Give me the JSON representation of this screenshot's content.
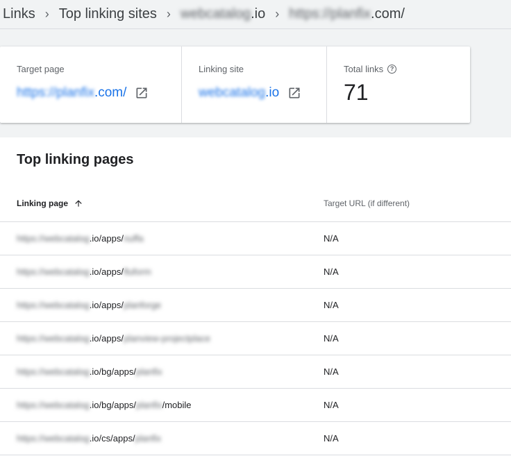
{
  "breadcrumb": {
    "links": "Links",
    "top_linking_sites": "Top linking sites",
    "site_blurred": "webcatalog",
    "site_suffix": ".io",
    "target_blurred": "https://planfix",
    "target_suffix": ".com/"
  },
  "summary": {
    "target_page": {
      "label": "Target page",
      "blurred": "https://planfix",
      "suffix": ".com/"
    },
    "linking_site": {
      "label": "Linking site",
      "blurred": "webcatalog",
      "suffix": ".io"
    },
    "total_links": {
      "label": "Total links",
      "value": "71"
    }
  },
  "section": {
    "title": "Top linking pages"
  },
  "table": {
    "col_linking_page": "Linking page",
    "col_target_url": "Target URL (if different)",
    "rows": [
      {
        "prefix": "https://webcatalog",
        "mid": ".io/apps/",
        "tail": "nuffa",
        "suffix": "",
        "target": "N/A"
      },
      {
        "prefix": "https://webcatalog",
        "mid": ".io/apps/",
        "tail": "fluform",
        "suffix": "",
        "target": "N/A"
      },
      {
        "prefix": "https://webcatalog",
        "mid": ".io/apps/",
        "tail": "planforge",
        "suffix": "",
        "target": "N/A"
      },
      {
        "prefix": "https://webcatalog",
        "mid": ".io/apps/",
        "tail": "planview-projectplace",
        "suffix": "",
        "target": "N/A"
      },
      {
        "prefix": "https://webcatalog",
        "mid": ".io/bg/apps/",
        "tail": "planfix",
        "suffix": "",
        "target": "N/A"
      },
      {
        "prefix": "https://webcatalog",
        "mid": ".io/bg/apps/",
        "tail": "planfix",
        "suffix": "/mobile",
        "target": "N/A"
      },
      {
        "prefix": "https://webcatalog",
        "mid": ".io/cs/apps/",
        "tail": "planfix",
        "suffix": "",
        "target": "N/A"
      }
    ]
  },
  "icons": {
    "external_link": "open-in-new-icon",
    "help": "help-outline-icon",
    "sort_up": "arrow-upward-icon",
    "chevron": "chevron-right-icon"
  },
  "colors": {
    "link": "#1a73e8",
    "header_bg": "#f1f3f4",
    "divider": "#dadce0"
  }
}
